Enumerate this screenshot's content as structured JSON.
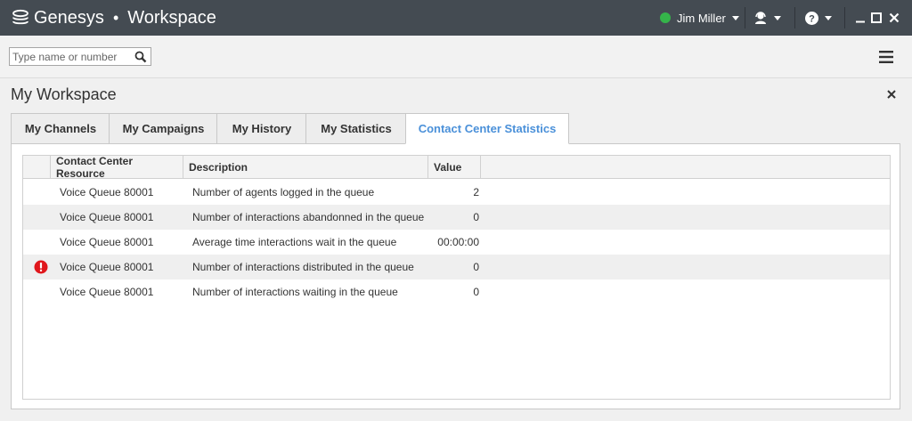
{
  "titlebar": {
    "brand": "Genesys",
    "separator": "•",
    "product": "Workspace",
    "agent_name": "Jim Miller",
    "agent_status_color": "#35b44a",
    "icons": [
      "genesys-logo-icon",
      "agent-status-icon",
      "help-icon",
      "minimize-icon",
      "maximize-icon",
      "close-icon"
    ]
  },
  "search": {
    "placeholder": "Type name or number",
    "value": ""
  },
  "workspace": {
    "title": "My Workspace",
    "tabs": [
      {
        "label": "My Channels",
        "active": false
      },
      {
        "label": "My Campaigns",
        "active": false
      },
      {
        "label": "My History",
        "active": false
      },
      {
        "label": "My Statistics",
        "active": false
      },
      {
        "label": "Contact Center Statistics",
        "active": true
      }
    ],
    "accent_color": "#4a90d9"
  },
  "stats_table": {
    "columns": [
      "Contact Center Resource",
      "Description",
      "Value"
    ],
    "rows": [
      {
        "resource": "Voice Queue 80001",
        "description": "Number of agents logged in the queue",
        "value": "2",
        "alert": false
      },
      {
        "resource": "Voice Queue 80001",
        "description": "Number of interactions abandonned in the queue",
        "value": "0",
        "alert": false
      },
      {
        "resource": "Voice Queue 80001",
        "description": "Average time interactions wait in the queue",
        "value": "00:00:00",
        "alert": false
      },
      {
        "resource": "Voice Queue 80001",
        "description": "Number of interactions distributed in the queue",
        "value": "0",
        "alert": true
      },
      {
        "resource": "Voice Queue 80001",
        "description": "Number of interactions waiting in the queue",
        "value": "0",
        "alert": false
      }
    ],
    "alert_color": "#e0171c"
  }
}
